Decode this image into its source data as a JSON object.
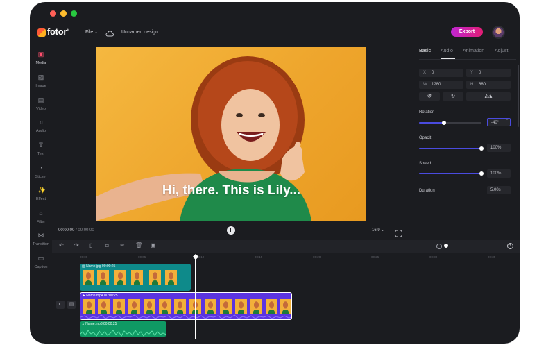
{
  "topbar": {
    "logo_text": "fotor",
    "logo_sup": "®",
    "file_menu": "File",
    "project_name": "Unnamed design",
    "export_label": "Export"
  },
  "sidebar": {
    "items": [
      {
        "label": "Media",
        "icon": "media-icon",
        "active": true
      },
      {
        "label": "Image",
        "icon": "image-icon"
      },
      {
        "label": "Video",
        "icon": "video-icon"
      },
      {
        "label": "Audio",
        "icon": "audio-icon"
      },
      {
        "label": "Text",
        "icon": "text-icon"
      },
      {
        "label": "Sticker",
        "icon": "sticker-icon"
      },
      {
        "label": "Effect",
        "icon": "effect-icon"
      },
      {
        "label": "Filter",
        "icon": "filter-icon"
      },
      {
        "label": "Transition",
        "icon": "transition-icon"
      },
      {
        "label": "Caption",
        "icon": "caption-icon"
      }
    ]
  },
  "preview": {
    "caption": "Hi, there. This is Lily...",
    "time_current": "00:00:00",
    "time_separator": "/",
    "time_total": "00:00:00",
    "aspect_ratio": "16:9"
  },
  "panel": {
    "tabs": [
      "Basic",
      "Audio",
      "Animation",
      "Adjust"
    ],
    "active_tab": "Basic",
    "x_label": "X",
    "x_value": "0",
    "y_label": "Y",
    "y_value": "0",
    "w_label": "W",
    "w_value": "1280",
    "h_label": "H",
    "h_value": "680",
    "rotation_label": "Rotation",
    "rotation_value": "-40°",
    "rotation_level": 0.4,
    "opacity_label": "Opacit",
    "opacity_value": "100%",
    "opacity_level": 1.0,
    "speed_label": "Speed",
    "speed_value": "100%",
    "speed_level": 1.0,
    "duration_label": "Duration",
    "duration_value": "5.00s"
  },
  "timeline": {
    "image_clip": {
      "name": "Name.jpg",
      "duration": "00:00:25"
    },
    "video_clip": {
      "name": "Name.mp4",
      "duration": "00:00:25"
    },
    "audio_clip": {
      "name": "Name.mp3",
      "duration": "00:00:25"
    },
    "ruler_labels": [
      "00:00",
      "00:05",
      "00:10",
      "00:15",
      "00:20",
      "00:25",
      "00:30",
      "00:35"
    ]
  },
  "colors": {
    "bg": "#1b1c20",
    "accent": "#4a4bdf",
    "export_start": "#c026d3",
    "export_end": "#e11d74",
    "image_track": "#0e8a8a",
    "video_track": "#5b34e0",
    "audio_track": "#0f9a64"
  }
}
